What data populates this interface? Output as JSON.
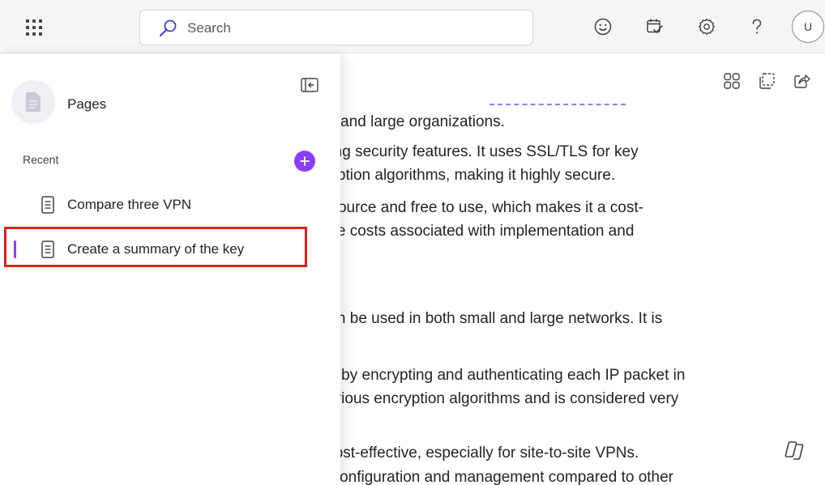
{
  "search": {
    "placeholder": "Search"
  },
  "topbar": {
    "icons": [
      "feedback-smiley-icon",
      "calendar-check-icon",
      "settings-gear-icon",
      "help-icon"
    ],
    "avatar_initial": "U"
  },
  "doc_toolbar": {
    "icons": [
      "apps-grid-icon",
      "copy-icon",
      "share-icon"
    ]
  },
  "sidebar": {
    "title": "Pages",
    "recent_label": "Recent",
    "items": [
      {
        "label": "Compare three VPN",
        "selected": false
      },
      {
        "label": "Create a summary of the key",
        "selected": true
      }
    ],
    "accent_color": "#8a3ffc"
  },
  "document": {
    "lines": [
      "mall and large organizations.",
      "strong security features. It uses SSL/TLS for key",
      "ncryption algorithms, making it highly secure.",
      "en-source and free to use, which makes it a cost-",
      "ay be costs associated with implementation and",
      "d can be used in both small and large networks. It is",
      "urity by encrypting and authenticating each IP packet in",
      "s various encryption algorithms and is considered very",
      "lly cost-effective, especially for site-to-site VPNs.",
      "lex configuration and management compared to other"
    ]
  },
  "annotation": {
    "highlight_color": "#e0211a"
  }
}
